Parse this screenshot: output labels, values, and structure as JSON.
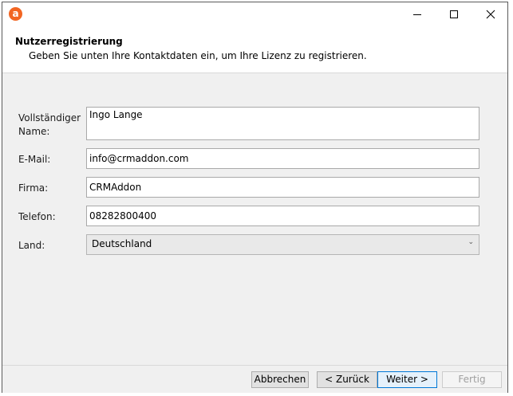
{
  "window": {
    "app_icon_letter": "a",
    "controls": {
      "minimize_icon": "minimize-icon",
      "maximize_icon": "maximize-icon",
      "close_icon": "close-icon"
    }
  },
  "header": {
    "title": "Nutzerregistrierung",
    "subtitle": "Geben Sie unten Ihre Kontaktdaten ein, um Ihre Lizenz zu registrieren."
  },
  "form": {
    "name_label": "Vollständiger Name:",
    "name_value": "Ingo Lange",
    "email_label": "E-Mail:",
    "email_value": "info@crmaddon.com",
    "company_label": "Firma:",
    "company_value": "CRMAddon",
    "phone_label": "Telefon:",
    "phone_value": "08282800400",
    "country_label": "Land:",
    "country_value": "Deutschland"
  },
  "buttons": {
    "cancel": "Abbrechen",
    "back": "< Zurück",
    "next": "Weiter >",
    "finish": "Fertig"
  },
  "colors": {
    "accent": "#f26522",
    "focus_border": "#0078d7"
  }
}
